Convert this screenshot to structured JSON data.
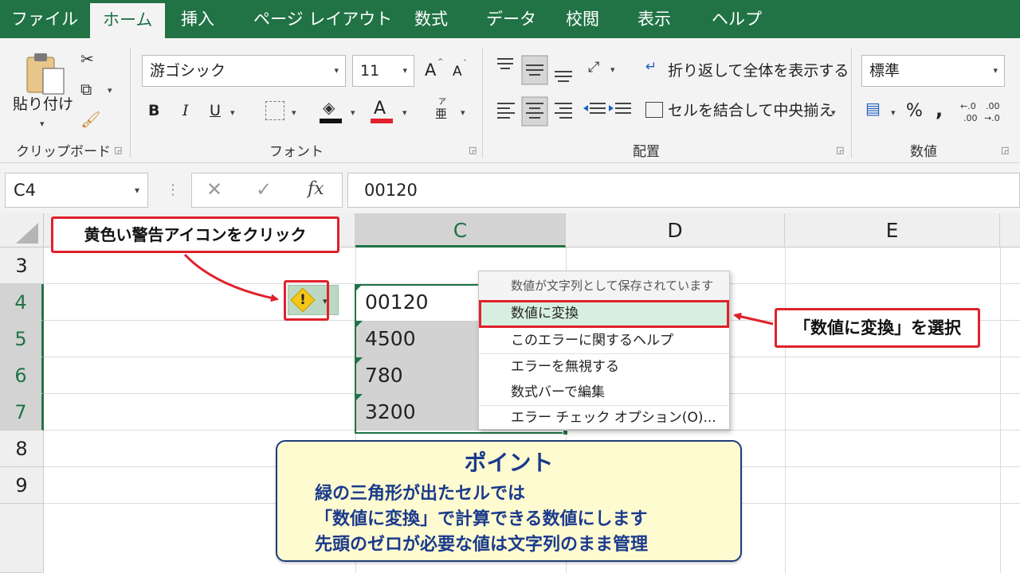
{
  "menu": {
    "tabs": [
      "ファイル",
      "ホーム",
      "挿入",
      "ページ レイアウト",
      "数式",
      "データ",
      "校閲",
      "表示",
      "ヘルプ"
    ],
    "active_index": 1
  },
  "ribbon": {
    "clipboard": {
      "paste_label": "貼り付け",
      "group_label": "クリップボード"
    },
    "font": {
      "font_name": "游ゴシック",
      "font_size": "11",
      "grow": "A",
      "shrink": "A",
      "bold": "B",
      "italic": "I",
      "underline": "U",
      "font_color_letter": "A",
      "phonetic": "亜",
      "phonetic_top": "ア",
      "group_label": "フォント"
    },
    "alignment": {
      "wrap_text": "折り返して全体を表示する",
      "merge_center": "セルを結合して中央揃え",
      "group_label": "配置"
    },
    "number": {
      "format": "標準",
      "percent": "%",
      "comma": ",",
      "group_label": "数値"
    }
  },
  "formula_bar": {
    "name_box": "C4",
    "fx": "fx",
    "value": "00120"
  },
  "sheet": {
    "columns": [
      "C",
      "D",
      "E"
    ],
    "rows": [
      "3",
      "4",
      "5",
      "6",
      "7",
      "8",
      "9"
    ],
    "cells": [
      "00120",
      "4500",
      "780",
      "3200"
    ]
  },
  "context_menu": {
    "header": "数値が文字列として保存されています",
    "items": [
      "数値に変換",
      "このエラーに関するヘルプ",
      "エラーを無視する",
      "数式バーで編集",
      "エラー チェック オプション(O)..."
    ]
  },
  "annotations": {
    "callout_left": "黄色い警告アイコンをクリック",
    "callout_right": "「数値に変換」を選択"
  },
  "point_box": {
    "title": "ポイント",
    "lines": [
      "緑の三角形が出たセルでは",
      "「数値に変換」で計算できる数値にします",
      "先頭のゼロが必要な値は文字列のまま管理"
    ]
  },
  "colors": {
    "excel_green": "#217346",
    "callout_red": "#e0212b",
    "point_blue": "#1a3a8c",
    "point_bg": "#fffbd0"
  }
}
